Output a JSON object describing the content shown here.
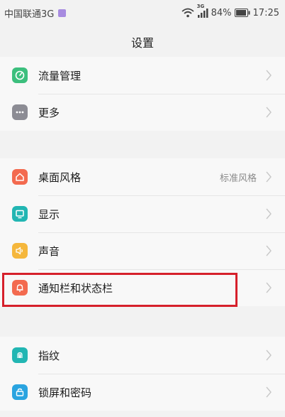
{
  "status_bar": {
    "carrier": "中国联通3G",
    "network": "3G",
    "battery": "84%",
    "time": "17:25"
  },
  "header": {
    "title": "设置"
  },
  "groups": [
    {
      "items": [
        {
          "label": "流量管理",
          "icon": "data-usage-icon",
          "color": "#3cbf7d"
        },
        {
          "label": "更多",
          "icon": "more-icon",
          "color": "#8c8c94"
        }
      ]
    },
    {
      "items": [
        {
          "label": "桌面风格",
          "value": "标准风格",
          "icon": "home-icon",
          "color": "#f36a4f"
        },
        {
          "label": "显示",
          "icon": "display-icon",
          "color": "#22b6b3"
        },
        {
          "label": "声音",
          "icon": "speaker-icon",
          "color": "#f5b73c"
        },
        {
          "label": "通知栏和状态栏",
          "icon": "bell-icon",
          "color": "#f36a4f",
          "highlighted": true
        }
      ]
    },
    {
      "items": [
        {
          "label": "指纹",
          "icon": "fingerprint-icon",
          "color": "#22b6b3"
        },
        {
          "label": "锁屏和密码",
          "icon": "lock-icon",
          "color": "#2aa4e0"
        }
      ]
    }
  ]
}
